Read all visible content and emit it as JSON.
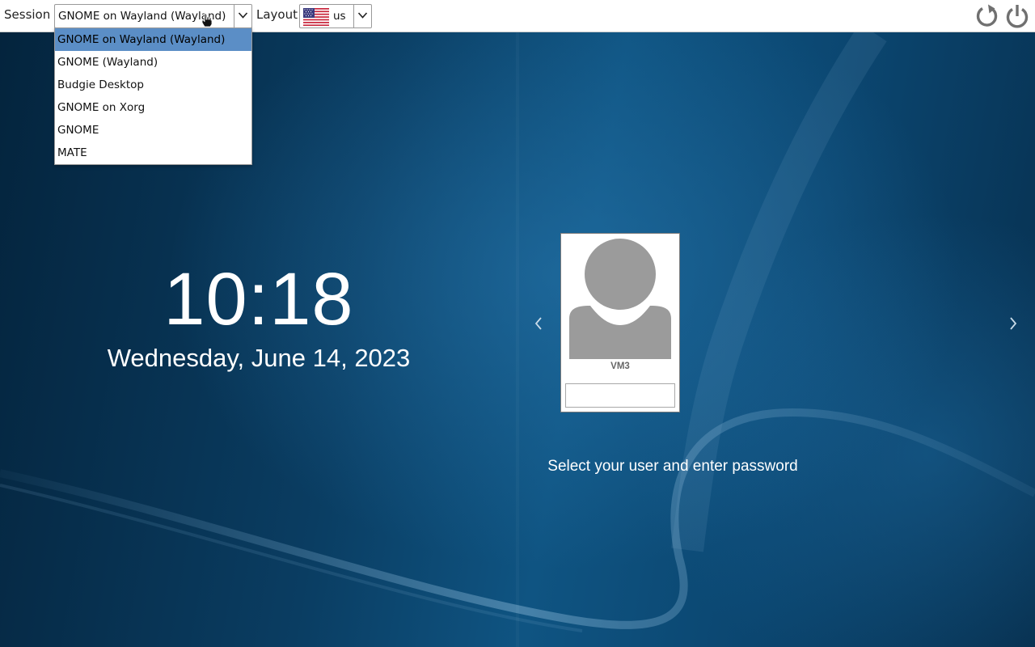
{
  "topbar": {
    "session_label": "Session",
    "session_value": "GNOME on Wayland (Wayland)",
    "layout_label": "Layout",
    "layout_value": "us",
    "layout_flag": "us-flag-icon"
  },
  "session_menu": {
    "items": [
      {
        "label": "GNOME on Wayland (Wayland)",
        "selected": true
      },
      {
        "label": "GNOME (Wayland)",
        "selected": false
      },
      {
        "label": "Budgie Desktop",
        "selected": false
      },
      {
        "label": "GNOME on Xorg",
        "selected": false
      },
      {
        "label": "GNOME",
        "selected": false
      },
      {
        "label": "MATE",
        "selected": false
      }
    ]
  },
  "actions": {
    "restart_icon": "restart-icon",
    "power_icon": "power-icon"
  },
  "clock": {
    "time": "10:18",
    "date": "Wednesday, June 14, 2023"
  },
  "login": {
    "username": "VM3",
    "password_value": "",
    "hint": "Select your user and enter password"
  },
  "colors": {
    "accent_selected": "#5b8ec6",
    "background": "#0b3a5c",
    "avatar_gray": "#9b9b9b"
  }
}
